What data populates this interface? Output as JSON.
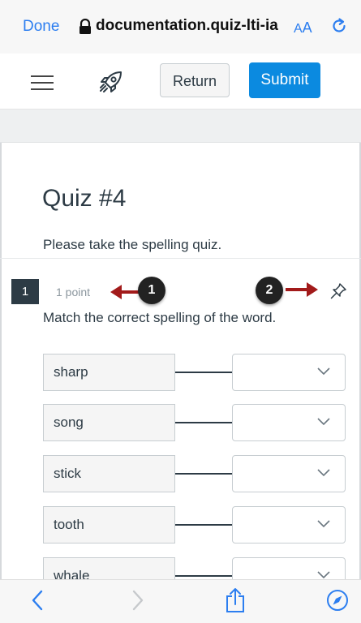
{
  "browser": {
    "done_label": "Done",
    "url": "documentation.quiz-lti-ia",
    "text_size_label_small": "A",
    "text_size_label_big": "A",
    "icons": [
      "lock-icon",
      "reload-icon",
      "back-icon",
      "forward-icon",
      "share-icon",
      "compass-icon"
    ]
  },
  "header": {
    "menu_icon": "hamburger-icon",
    "logo_icon": "rocket-icon",
    "return_label": "Return",
    "submit_label": "Submit"
  },
  "quiz": {
    "title": "Quiz #4",
    "description": "Please take the spelling quiz.",
    "question": {
      "number": "1",
      "points": "1 point",
      "text": "Match the correct spelling of the word.",
      "pin_icon": "pin-icon",
      "pairs": [
        {
          "term": "sharp",
          "selected": ""
        },
        {
          "term": "song",
          "selected": ""
        },
        {
          "term": "stick",
          "selected": ""
        },
        {
          "term": "tooth",
          "selected": ""
        },
        {
          "term": "whale",
          "selected": ""
        }
      ]
    }
  },
  "callouts": [
    "1",
    "2"
  ],
  "colors": {
    "submit": "#0b8ae0",
    "link": "#2c7ef0",
    "callout_arrow": "#a21a1a",
    "question_badge": "#2d3b45"
  }
}
